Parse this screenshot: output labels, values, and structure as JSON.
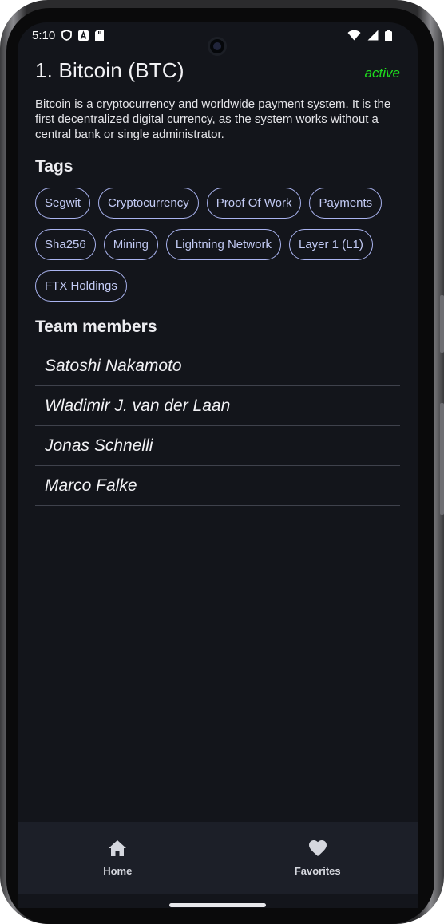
{
  "status_bar": {
    "time": "5:10",
    "left_icons": [
      "shield-icon",
      "a-badge-icon",
      "sd-card-icon"
    ],
    "right_icons": [
      "wifi-icon",
      "signal-icon",
      "battery-icon"
    ]
  },
  "detail": {
    "title": "1. Bitcoin (BTC)",
    "status": "active",
    "description": "Bitcoin is a cryptocurrency and worldwide payment system. It is the first decentralized digital currency, as the system works without a central bank or single administrator."
  },
  "tags_section": {
    "title": "Tags",
    "items": [
      "Segwit",
      "Cryptocurrency",
      "Proof Of Work",
      "Payments",
      "Sha256",
      "Mining",
      "Lightning Network",
      "Layer 1 (L1)",
      "FTX Holdings"
    ]
  },
  "team_section": {
    "title": "Team members",
    "members": [
      "Satoshi Nakamoto",
      "Wladimir J. van der Laan",
      "Jonas Schnelli",
      "Marco Falke"
    ]
  },
  "bottom_nav": {
    "items": [
      {
        "label": "Home",
        "icon": "home-icon"
      },
      {
        "label": "Favorites",
        "icon": "heart-icon"
      }
    ]
  },
  "colors": {
    "background": "#13151b",
    "status_active": "#1fdd1f",
    "chip_border": "#aab4f0",
    "nav_background": "#1c1f28"
  }
}
